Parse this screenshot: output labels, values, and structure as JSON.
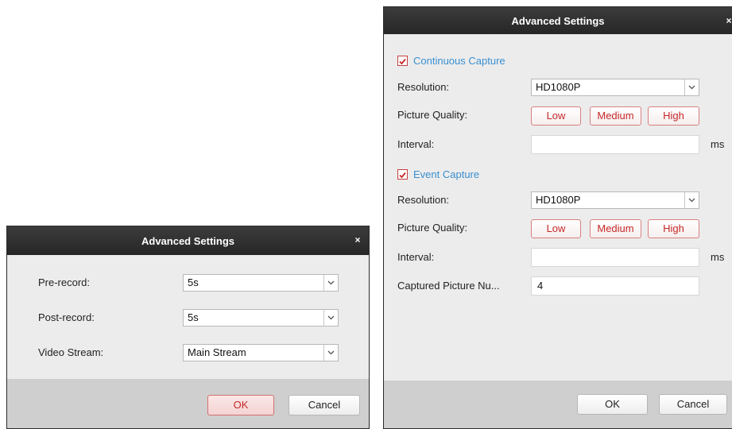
{
  "left_dialog": {
    "title": "Advanced Settings",
    "close_glyph": "×",
    "rows": [
      {
        "label": "Pre-record:",
        "value": "5s"
      },
      {
        "label": "Post-record:",
        "value": "5s"
      },
      {
        "label": "Video Stream:",
        "value": "Main Stream"
      }
    ],
    "ok_label": "OK",
    "cancel_label": "Cancel"
  },
  "right_dialog": {
    "title": "Advanced Settings",
    "close_glyph": "×",
    "continuous": {
      "title": "Continuous Capture",
      "checked": true,
      "resolution_label": "Resolution:",
      "resolution_value": "HD1080P",
      "quality_label": "Picture Quality:",
      "quality_options": [
        "Low",
        "Medium",
        "High"
      ],
      "interval_label": "Interval:",
      "interval_value": "",
      "interval_unit": "ms"
    },
    "event": {
      "title": "Event Capture",
      "checked": true,
      "resolution_label": "Resolution:",
      "resolution_value": "HD1080P",
      "quality_label": "Picture Quality:",
      "quality_options": [
        "Low",
        "Medium",
        "High"
      ],
      "interval_label": "Interval:",
      "interval_value": "",
      "interval_unit": "ms",
      "captured_label": "Captured Picture Nu...",
      "captured_value": "4"
    },
    "ok_label": "OK",
    "cancel_label": "Cancel"
  },
  "colors": {
    "titlebar": "#2f2f2f",
    "accent_red": "#c62828",
    "section_blue": "#3a8fd0",
    "body_bg": "#ececec",
    "footer_bg": "#cfcfcf"
  },
  "icons": {
    "dropdown": "chevron-down-icon",
    "check": "checkmark-icon",
    "close": "close-icon"
  }
}
